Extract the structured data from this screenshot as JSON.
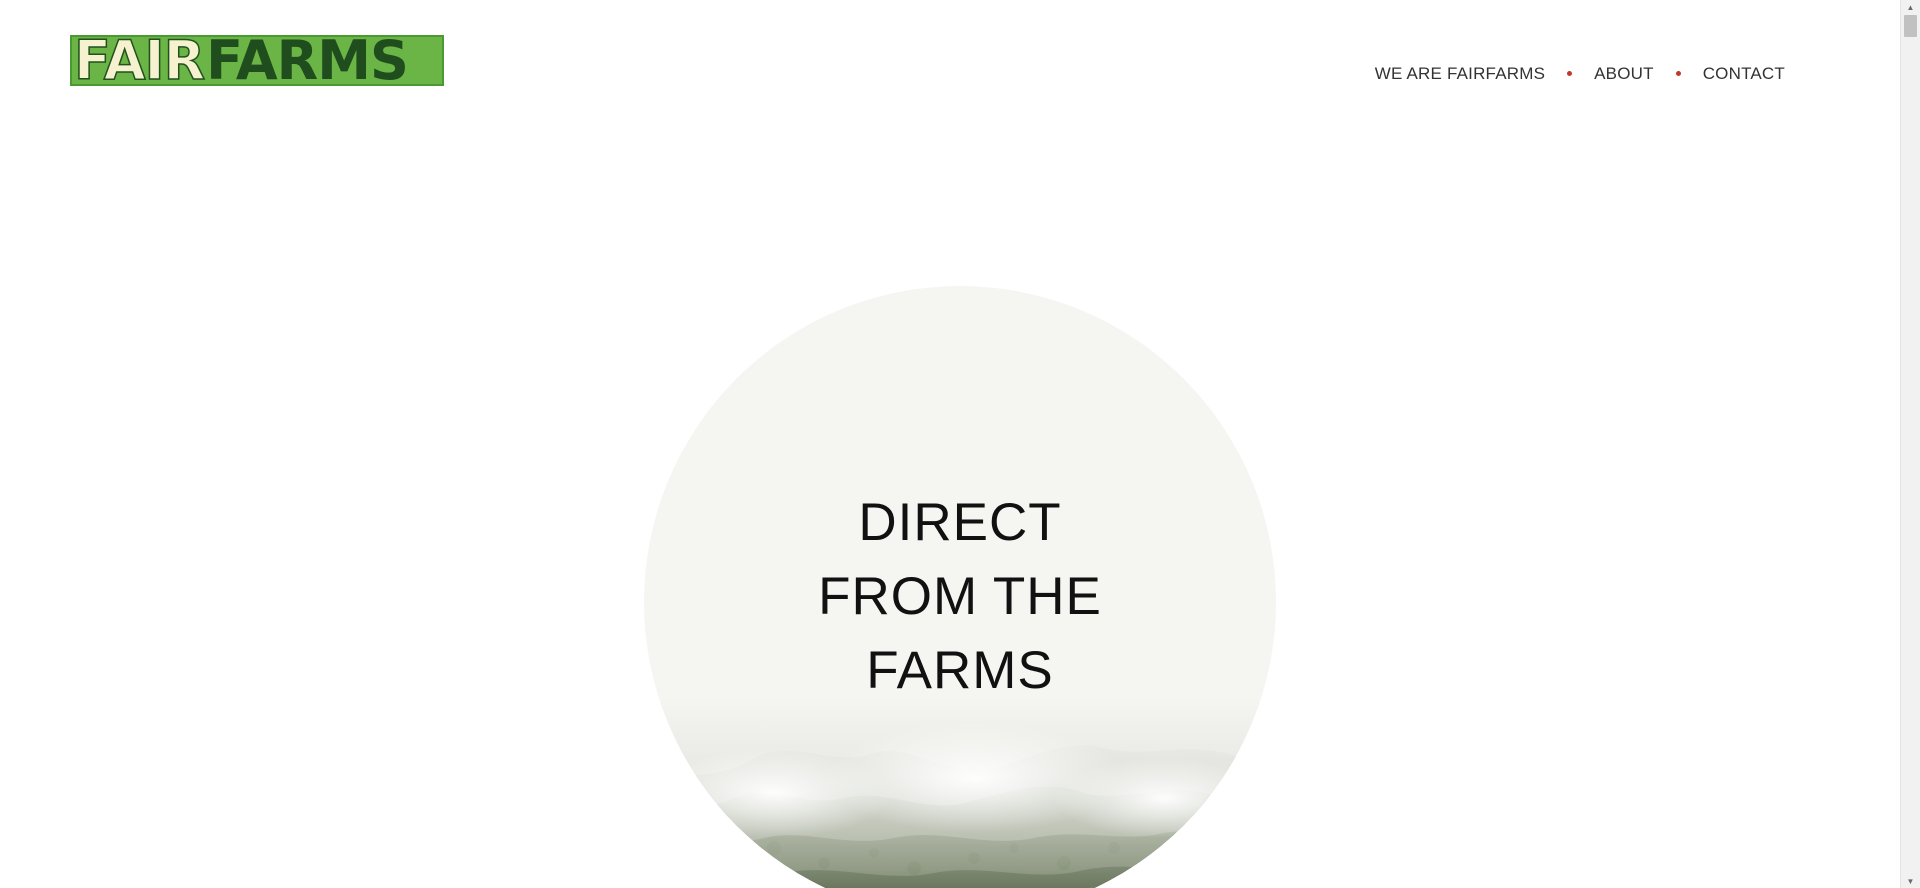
{
  "brand": {
    "logo_part1": "FAIR",
    "logo_part2": "FARMS",
    "colors": {
      "logo_background": "#6ab546",
      "logo_fair": "#f6f2cf",
      "logo_farms": "#1f4d1d",
      "nav_dot": "#c0392b",
      "hero_circle": "#f5f5f1"
    }
  },
  "nav": {
    "items": [
      {
        "label": "WE ARE FAIRFARMS"
      },
      {
        "label": "ABOUT"
      },
      {
        "label": "CONTACT"
      }
    ]
  },
  "hero": {
    "title_line1": "DIRECT",
    "title_line2": "FROM THE",
    "title_line3": "FARMS",
    "image": "misty-forest"
  },
  "scrollbar": {
    "up_icon": "chevron-up-icon",
    "down_icon": "chevron-down-icon"
  }
}
